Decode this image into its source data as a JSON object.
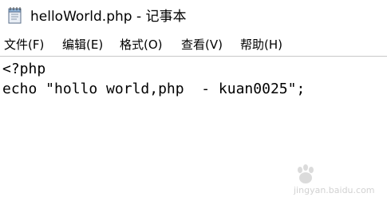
{
  "window": {
    "title": "helloWorld.php - 记事本",
    "icon": "notepad-icon"
  },
  "menu": [
    {
      "label": "文件(F)"
    },
    {
      "label": "编辑(E)"
    },
    {
      "label": "格式(O)"
    },
    {
      "label": "查看(V)"
    },
    {
      "label": "帮助(H)"
    }
  ],
  "editor": {
    "lines": [
      "<?php",
      "echo \"hollo world,php  - kuan0025\";"
    ]
  },
  "watermark": {
    "text": "jingyan.baidu.com",
    "icon": "baidu-paw-logo"
  }
}
